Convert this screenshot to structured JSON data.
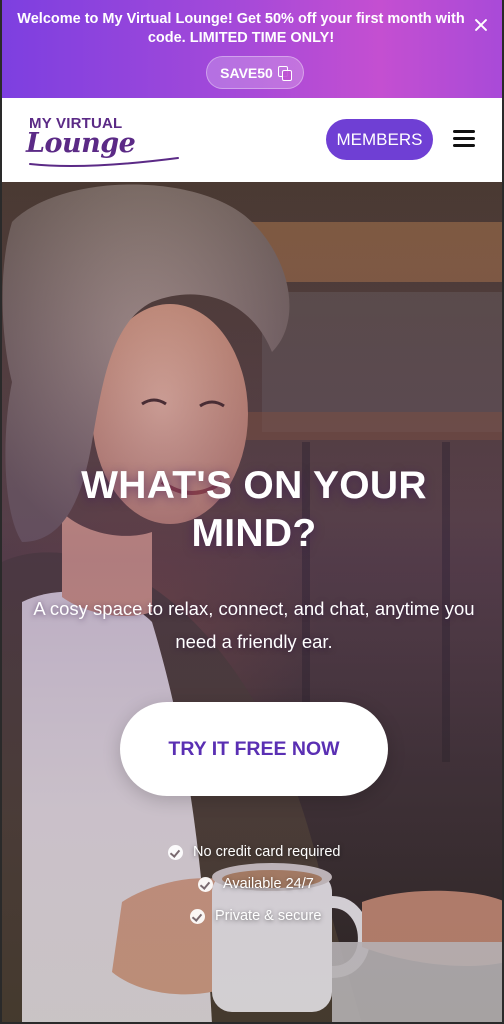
{
  "promo": {
    "text": "Welcome to My Virtual Lounge! Get 50% off your first month with code. LIMITED TIME ONLY!",
    "coupon_code": "SAVE50",
    "copy_icon": "copy-icon",
    "close_icon": "close-icon"
  },
  "header": {
    "logo_top": "MY VIRTUAL",
    "logo_script": "Lounge",
    "members_label": "MEMBERS",
    "menu_icon": "hamburger-menu-icon"
  },
  "hero": {
    "title": "WHAT'S ON YOUR MIND?",
    "subtitle": "A cosy space to relax, connect, and chat, anytime you need a friendly ear.",
    "cta_label": "TRY IT FREE NOW",
    "checks": [
      "No credit card required",
      "Available 24/7",
      "Private & secure"
    ]
  },
  "colors": {
    "brand_purple": "#6f3fd4",
    "logo_purple": "#5b2a86",
    "banner_gradient_start": "#7d3fe0",
    "banner_gradient_end": "#c44fd1"
  }
}
